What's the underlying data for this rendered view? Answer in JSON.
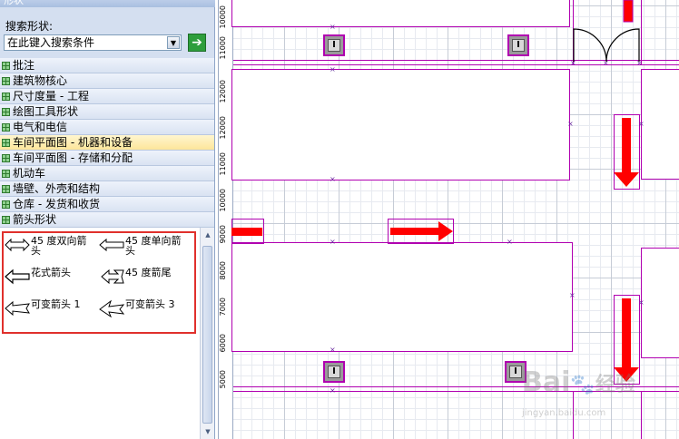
{
  "panel": {
    "title": "形状",
    "search_label": "搜索形状:",
    "search_placeholder": "在此键入搜索条件",
    "search_go_icon": "green-arrow-right-icon"
  },
  "stencils": [
    {
      "label": "批注",
      "active": false
    },
    {
      "label": "建筑物核心",
      "active": false
    },
    {
      "label": "尺寸度量 - 工程",
      "active": false
    },
    {
      "label": "绘图工具形状",
      "active": false
    },
    {
      "label": "电气和电信",
      "active": false
    },
    {
      "label": "车间平面图 - 机器和设备",
      "active": true
    },
    {
      "label": "车间平面图 - 存储和分配",
      "active": false
    },
    {
      "label": "机动车",
      "active": false
    },
    {
      "label": "墙壁、外壳和结构",
      "active": false
    },
    {
      "label": "仓库 - 发货和收货",
      "active": false
    },
    {
      "label": "箭头形状",
      "active": false
    }
  ],
  "shapes": [
    {
      "label": "45 度双向箭头",
      "icon": "double-arrow-icon"
    },
    {
      "label": "45 度单向箭头",
      "icon": "single-arrow-icon"
    },
    {
      "label": "花式箭头",
      "icon": "fancy-arrow-icon"
    },
    {
      "label": "45 度箭尾",
      "icon": "arrow-tail-icon"
    },
    {
      "label": "可变箭头 1",
      "icon": "variable-arrow-1-icon"
    },
    {
      "label": "可变箭头 3",
      "icon": "variable-arrow-3-icon"
    }
  ],
  "ruler": {
    "labels": [
      "10000",
      "11000",
      "12000",
      "11000",
      "10000",
      "9000",
      "8000",
      "7000",
      "6000",
      "5000"
    ]
  },
  "canvas": {
    "accent_color": "#b000b0",
    "arrow_color": "#ff0000",
    "column_icon": "I-beam-column-icon",
    "door_icon": "double-door-icon"
  },
  "watermark": {
    "brand": "Bai",
    "suffix": "经验",
    "url": "jingyan.baidu.com"
  }
}
